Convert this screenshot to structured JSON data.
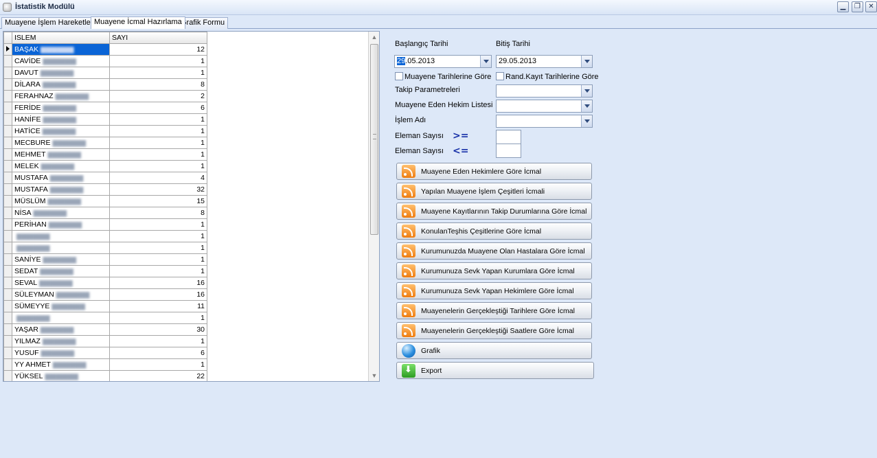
{
  "window": {
    "title": "İstatistik Modülü",
    "controls": [
      "minimize",
      "restore",
      "close"
    ]
  },
  "tabs": [
    {
      "label": "Muayene İşlem Hareketleri",
      "active": false
    },
    {
      "label": "Muayene İcmal Hazırlama",
      "active": true
    },
    {
      "label": "Grafik Formu",
      "active": false
    }
  ],
  "grid": {
    "columns": [
      "ISLEM",
      "SAYI"
    ],
    "rows": [
      {
        "name": "BAŞAK",
        "count": "12"
      },
      {
        "name": "CAVİDE",
        "count": "1"
      },
      {
        "name": "DAVUT",
        "count": "1"
      },
      {
        "name": "DİLARA",
        "count": "8"
      },
      {
        "name": "FERAHNAZ",
        "count": "2"
      },
      {
        "name": "FERİDE",
        "count": "6"
      },
      {
        "name": "HANİFE",
        "count": "1"
      },
      {
        "name": "HATİCE",
        "count": "1"
      },
      {
        "name": "MECBURE",
        "count": "1"
      },
      {
        "name": "MEHMET",
        "count": "1"
      },
      {
        "name": "MELEK",
        "count": "1"
      },
      {
        "name": "MUSTAFA",
        "count": "4"
      },
      {
        "name": "MUSTAFA",
        "count": "32"
      },
      {
        "name": "MÜSLÜM",
        "count": "15"
      },
      {
        "name": "NİSA",
        "count": "8"
      },
      {
        "name": "PERİHAN",
        "count": "1"
      },
      {
        "name": "",
        "count": "1"
      },
      {
        "name": "",
        "count": "1"
      },
      {
        "name": "SANİYE",
        "count": "1"
      },
      {
        "name": "SEDAT",
        "count": "1"
      },
      {
        "name": "SEVAL",
        "count": "16"
      },
      {
        "name": "SÜLEYMAN",
        "count": "16"
      },
      {
        "name": "SÜMEYYE",
        "count": "11"
      },
      {
        "name": "",
        "count": "1"
      },
      {
        "name": "YAŞAR",
        "count": "30"
      },
      {
        "name": "YILMAZ",
        "count": "1"
      },
      {
        "name": "YUSUF",
        "count": "6"
      },
      {
        "name": "YY AHMET",
        "count": "1"
      },
      {
        "name": "YÜKSEL",
        "count": "22"
      }
    ]
  },
  "form": {
    "start_date_label": "Başlangıç Tarihi",
    "end_date_label": "Bitiş Tarihi",
    "start_date_selected": "29",
    "start_date_rest": ".05.2013",
    "end_date": "29.05.2013",
    "chk_muayene_label": "Muayene Tarihlerine Göre",
    "chk_rand_label": "Rand.Kayıt Tarihlerine Göre",
    "takip_label": "Takip Parametreleri",
    "hekim_label": "Muayene Eden Hekim Listesi",
    "islem_label": "İşlem Adı",
    "eleman_label_1": "Eleman Sayısı",
    "eleman_label_2": "Eleman Sayısı",
    "op_gte": ">=",
    "op_lte": "<="
  },
  "buttons": {
    "b1": "Muayene Eden Hekimlere Göre İcmal",
    "b2": "Yapılan Muayene İşlem Çeşitleri İcmali",
    "b3": "Muayene Kayıtlarının Takip Durumlarına Göre İcmal",
    "b4": "KonulanTeşhis Çeşitlerine Göre  İcmal",
    "b5": "Kurumunuzda Muayene Olan Hastalara Göre İcmal",
    "b6": "Kurumunuza Sevk Yapan Kurumlara Göre İcmal",
    "b7": "Kurumunuza Sevk Yapan Hekimlere Göre İcmal",
    "b8": "Muayenelerin Gerçekleştiği Tarihlere Göre İcmal",
    "b9": "Muayenelerin Gerçekleştiği Saatlere Göre İcmal",
    "grafik": "Grafik",
    "export": "Export"
  },
  "icons": {
    "report_button_icon": "rss-icon",
    "grafik_icon": "globe-icon",
    "export_icon": "download-icon"
  }
}
